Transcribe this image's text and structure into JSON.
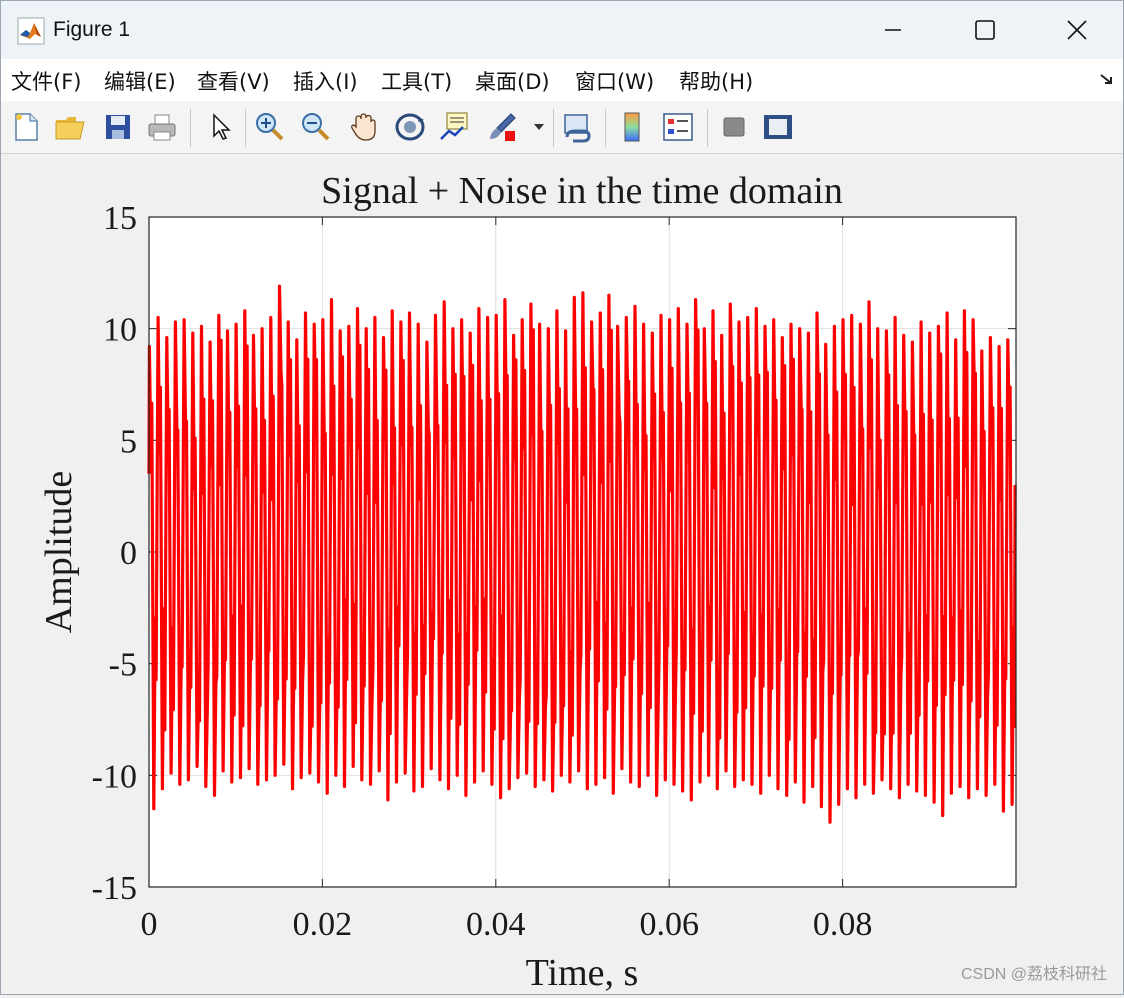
{
  "window": {
    "title": "Figure 1",
    "icons": {
      "app": "matlab-logo-icon",
      "minimize": "minimize-icon",
      "maximize": "maximize-icon",
      "close": "close-icon"
    }
  },
  "menu": {
    "items": [
      "文件(F)",
      "编辑(E)",
      "查看(V)",
      "插入(I)",
      "工具(T)",
      "桌面(D)",
      "窗口(W)",
      "帮助(H)"
    ],
    "dock_icon": "dock-arrow-icon"
  },
  "toolbar": {
    "tools": [
      "new-figure-icon",
      "open-file-icon",
      "save-icon",
      "print-icon",
      "select-pointer-icon",
      "zoom-in-icon",
      "zoom-out-icon",
      "pan-icon",
      "rotate-3d-icon",
      "data-tips-icon",
      "brush-icon",
      "brush-dropdown-icon",
      "link-plot-icon",
      "colorbar-icon",
      "legend-icon",
      "hide-plot-tools-icon",
      "show-plot-tools-icon"
    ]
  },
  "colors": {
    "line": "#ff0000",
    "grid": "#dfdfdf",
    "axes_background": "#ffffff",
    "figure_background": "#f0f0f0"
  },
  "chart_data": {
    "type": "line",
    "title": "Signal + Noise in the time domain",
    "xlabel": "Time, s",
    "ylabel": "Amplitude",
    "xlim": [
      0,
      0.1
    ],
    "ylim": [
      -15,
      15
    ],
    "xticks": [
      0,
      0.02,
      0.04,
      0.06,
      0.08
    ],
    "xtick_labels": [
      "0",
      "0.02",
      "0.04",
      "0.06",
      "0.08"
    ],
    "yticks": [
      15,
      10,
      5,
      0,
      -5,
      -10,
      -15
    ],
    "ytick_labels": [
      "15",
      "10",
      "5",
      "0",
      "-5",
      "-10",
      "-15"
    ],
    "grid": true,
    "series": [
      {
        "color": "#ff0000",
        "description": "dense oscillation of about 100 cycles over 0–0.1 s with amplitude roughly ±10 plus noise",
        "peak_x": [
          0.0,
          0.001,
          0.002,
          0.003,
          0.004,
          0.005,
          0.006,
          0.007,
          0.008,
          0.009,
          0.01,
          0.011,
          0.012,
          0.013,
          0.014,
          0.015,
          0.016,
          0.017,
          0.018,
          0.019,
          0.02,
          0.021,
          0.022,
          0.023,
          0.024,
          0.025,
          0.026,
          0.027,
          0.028,
          0.029,
          0.03,
          0.031,
          0.032,
          0.033,
          0.034,
          0.035,
          0.036,
          0.037,
          0.038,
          0.039,
          0.04,
          0.041,
          0.042,
          0.043,
          0.044,
          0.045,
          0.046,
          0.047,
          0.048,
          0.049,
          0.05,
          0.051,
          0.052,
          0.053,
          0.054,
          0.055,
          0.056,
          0.057,
          0.058,
          0.059,
          0.06,
          0.061,
          0.062,
          0.063,
          0.064,
          0.065,
          0.066,
          0.067,
          0.068,
          0.069,
          0.07,
          0.071,
          0.072,
          0.073,
          0.074,
          0.075,
          0.076,
          0.077,
          0.078,
          0.079,
          0.08,
          0.081,
          0.082,
          0.083,
          0.084,
          0.085,
          0.086,
          0.087,
          0.088,
          0.089,
          0.09,
          0.091,
          0.092,
          0.093,
          0.094,
          0.095,
          0.096,
          0.097,
          0.098,
          0.099
        ],
        "peak_values": [
          9.2,
          10.5,
          9.6,
          10.3,
          10.4,
          9.8,
          10.1,
          9.4,
          10.6,
          9.9,
          10.2,
          10.8,
          9.7,
          10.0,
          10.5,
          11.9,
          10.3,
          9.5,
          10.7,
          10.2,
          10.4,
          11.3,
          9.9,
          10.1,
          10.9,
          10.0,
          10.5,
          9.6,
          10.8,
          10.3,
          10.7,
          10.2,
          9.4,
          10.6,
          11.2,
          10.0,
          10.4,
          9.8,
          10.9,
          10.5,
          10.6,
          11.3,
          9.7,
          10.4,
          11.1,
          10.2,
          10.0,
          10.8,
          9.9,
          11.4,
          11.6,
          10.3,
          10.7,
          11.5,
          10.1,
          10.5,
          11.0,
          10.2,
          9.8,
          10.6,
          10.4,
          10.9,
          10.2,
          11.3,
          10.0,
          10.8,
          9.7,
          11.1,
          10.3,
          10.5,
          10.9,
          10.1,
          10.4,
          9.6,
          10.2,
          10.0,
          9.8,
          10.7,
          9.3,
          10.1,
          10.4,
          10.6,
          10.2,
          11.2,
          10.0,
          9.9,
          10.5,
          9.7,
          9.4,
          10.3,
          9.8,
          10.1,
          10.7,
          9.5,
          10.8,
          10.4,
          9.0,
          9.6,
          9.2,
          9.5
        ],
        "trough_values": [
          -11.5,
          -10.6,
          -9.9,
          -10.4,
          -10.2,
          -9.6,
          -10.5,
          -10.9,
          -9.8,
          -10.3,
          -10.1,
          -9.7,
          -10.4,
          -10.2,
          -10.0,
          -9.5,
          -10.6,
          -10.1,
          -9.9,
          -10.3,
          -10.8,
          -10.0,
          -10.5,
          -9.6,
          -10.2,
          -10.4,
          -9.8,
          -11.1,
          -10.3,
          -9.9,
          -10.7,
          -10.5,
          -9.7,
          -10.2,
          -10.6,
          -10.0,
          -10.9,
          -10.3,
          -9.8,
          -10.4,
          -11.0,
          -10.6,
          -10.1,
          -9.9,
          -10.5,
          -10.2,
          -10.7,
          -10.0,
          -10.3,
          -9.8,
          -10.6,
          -10.4,
          -10.1,
          -10.8,
          -9.7,
          -10.3,
          -10.5,
          -10.0,
          -10.9,
          -10.2,
          -10.4,
          -10.7,
          -11.1,
          -10.3,
          -10.0,
          -10.6,
          -9.8,
          -10.5,
          -10.2,
          -10.4,
          -10.8,
          -10.0,
          -10.6,
          -10.9,
          -10.3,
          -11.2,
          -10.5,
          -11.4,
          -12.1,
          -11.3,
          -10.6,
          -11.0,
          -10.4,
          -10.8,
          -10.2,
          -10.6,
          -11.0,
          -10.4,
          -10.7,
          -10.9,
          -11.2,
          -11.8,
          -10.8,
          -10.5,
          -11.0,
          -10.6,
          -10.9,
          -10.4,
          -11.6,
          -11.3
        ]
      }
    ]
  },
  "watermark": "CSDN @荔枝科研社"
}
